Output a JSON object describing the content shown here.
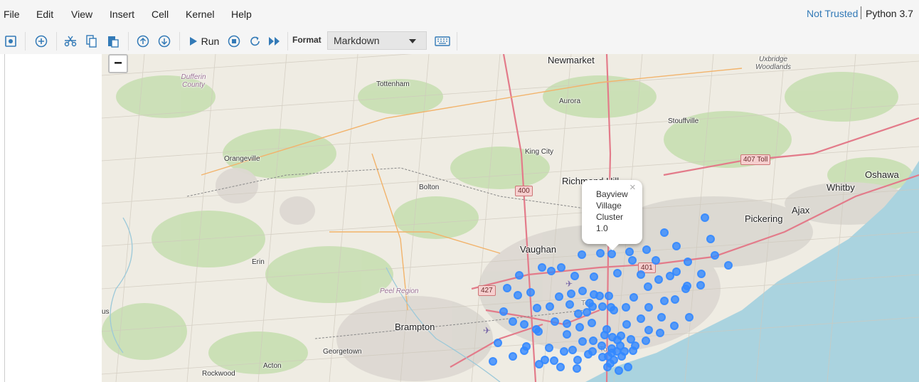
{
  "menubar": {
    "items": [
      "File",
      "Edit",
      "View",
      "Insert",
      "Cell",
      "Kernel",
      "Help"
    ],
    "trust_status": "Not Trusted",
    "kernel": "Python 3.7"
  },
  "toolbar": {
    "run_label": "Run",
    "format_label": "Format",
    "cell_type": "Markdown",
    "icons": [
      "save-icon",
      "plus-icon",
      "cut-icon",
      "copy-icon",
      "paste-icon",
      "arrow-up-icon",
      "arrow-down-icon",
      "run-icon",
      "stop-icon",
      "restart-icon",
      "fast-forward-icon",
      "keyboard-icon"
    ]
  },
  "map": {
    "zoom_out_label": "−",
    "places": [
      "Newmarket",
      "Uxbridge Woodlands",
      "Dufferin County",
      "Tottenham",
      "Aurora",
      "Stouffville",
      "Orangeville",
      "King City",
      "407 Toll",
      "Oshawa",
      "Bolton",
      "400",
      "Richmond Hill",
      "Whitby",
      "Ajax",
      "Pickering",
      "Vaughan",
      "401",
      "Erin",
      "427",
      "Peel Region",
      "Brampton",
      "Georgetown",
      "Acton",
      "Rockwood",
      "us",
      "Tor",
      "To"
    ],
    "popup": {
      "lines": [
        "Bayview",
        "Village",
        "Cluster",
        "1.0"
      ],
      "close": "×"
    },
    "marker_color": "#3388ff",
    "water_color": "#aad3df"
  }
}
